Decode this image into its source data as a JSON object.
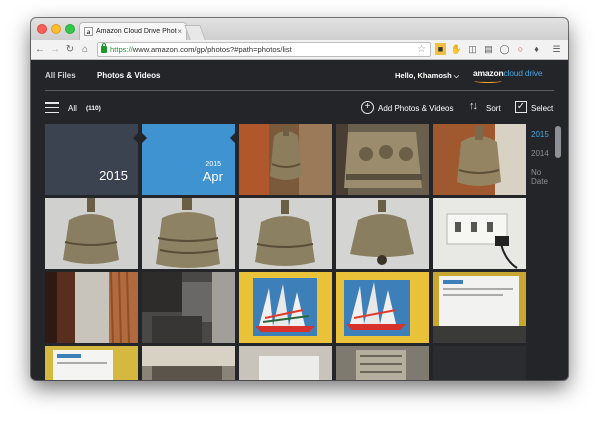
{
  "browser": {
    "tab_title": "Amazon Cloud Drive Photos",
    "tab_close": "×",
    "favicon_letter": "a",
    "url_scheme": "https://",
    "url_rest": "www.amazon.com/gp/photos?#path=photos/list"
  },
  "header": {
    "nav": [
      "All Files",
      "Photos & Videos"
    ],
    "greeting": "Hello, Khamosh",
    "logo_amazon": "amazon",
    "logo_cloud_drive": "cloud drive"
  },
  "actionbar": {
    "filter_label": "All",
    "filter_count": "(110)",
    "add_label": "Add Photos & Videos",
    "sort_label": "Sort",
    "select_label": "Select"
  },
  "grid": {
    "year_tile": "2015",
    "month_tile_year": "2015",
    "month_tile_month": "Apr",
    "photos": [
      {
        "row": 0,
        "col": 2,
        "subject": "brass bell"
      },
      {
        "row": 0,
        "col": 3,
        "subject": "brass bell"
      },
      {
        "row": 0,
        "col": 4,
        "subject": "brass bell"
      },
      {
        "row": 1,
        "col": 0,
        "subject": "brass bell"
      },
      {
        "row": 1,
        "col": 1,
        "subject": "brass bell"
      },
      {
        "row": 1,
        "col": 2,
        "subject": "brass bell"
      },
      {
        "row": 1,
        "col": 3,
        "subject": "brass bell"
      },
      {
        "row": 1,
        "col": 4,
        "subject": "power socket"
      },
      {
        "row": 2,
        "col": 0,
        "subject": "window curtain"
      },
      {
        "row": 2,
        "col": 1,
        "subject": "room"
      },
      {
        "row": 2,
        "col": 2,
        "subject": "sailboat painting"
      },
      {
        "row": 2,
        "col": 3,
        "subject": "sailboat painting"
      },
      {
        "row": 2,
        "col": 4,
        "subject": "laptop screen"
      },
      {
        "row": 3,
        "col": 0,
        "subject": "laptop screen"
      },
      {
        "row": 3,
        "col": 1,
        "subject": "desk"
      },
      {
        "row": 3,
        "col": 2,
        "subject": "desk"
      },
      {
        "row": 3,
        "col": 3,
        "subject": "desk"
      },
      {
        "row": 3,
        "col": 4,
        "subject": "dark"
      }
    ]
  },
  "timeline": [
    "2015",
    "2014",
    "No Date"
  ],
  "colors": {
    "accent": "#4aa3df",
    "header_bg": "#232529",
    "year_tile": "#3c4350",
    "month_tile": "#3e93d0",
    "logo_smile": "#f2a02a"
  },
  "icons": {
    "menu": "hamburger-icon",
    "add": "plus-circle-icon",
    "sort": "sort-arrows-icon",
    "select": "checkbox-icon",
    "user_menu": "chevron-down-icon"
  }
}
